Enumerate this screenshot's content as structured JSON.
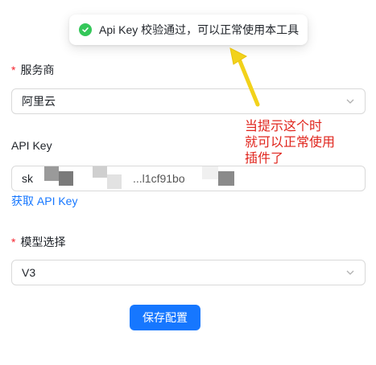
{
  "toast": {
    "message": "Api Key 校验通过，可以正常使用本工具",
    "icon": "check-circle-icon",
    "icon_color": "#34c759"
  },
  "provider": {
    "label": "服务商",
    "required_mark": "*",
    "value": "阿里云"
  },
  "api_key": {
    "label": "API Key",
    "value_prefix": "sk",
    "value_partial": "...l1cf91bo",
    "link": "获取 API Key"
  },
  "model": {
    "label": "模型选择",
    "required_mark": "*",
    "value": "V3"
  },
  "save_button": {
    "label": "保存配置",
    "color": "#1677ff"
  },
  "annotation": {
    "lines": [
      "当提示这个时",
      "就可以正常使用",
      "插件了"
    ],
    "color": "#e0261e",
    "arrow_color": "#f2d21b"
  }
}
